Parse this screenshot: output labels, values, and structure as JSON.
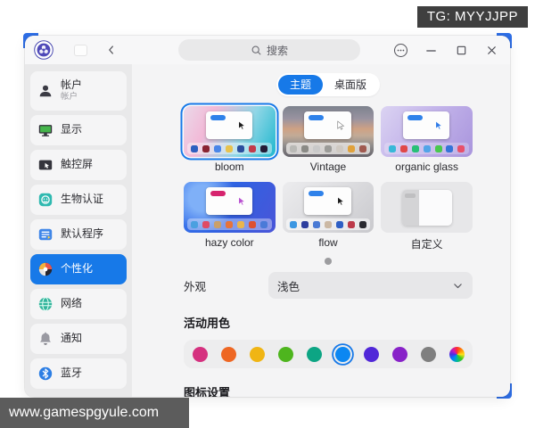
{
  "watermarks": {
    "top_right": "TG: MYYJJPP",
    "bottom_left": "www.gamespgyule.com"
  },
  "ui_colors": {
    "accent_blue": "#1779e8",
    "sidebar_bg": "#e9e9ea",
    "content_bg": "#f4f4f5"
  },
  "window": {
    "titlebar": {
      "search_placeholder": "搜索"
    },
    "sidebar": {
      "items": [
        {
          "label": "帐户",
          "sublabel": "帐户",
          "icon": "account-icon",
          "selected": false
        },
        {
          "label": "显示",
          "icon": "display-icon",
          "selected": false
        },
        {
          "label": "触控屏",
          "icon": "touchscreen-icon",
          "selected": false
        },
        {
          "label": "生物认证",
          "icon": "biometric-icon",
          "selected": false
        },
        {
          "label": "默认程序",
          "icon": "default-apps-icon",
          "selected": false
        },
        {
          "label": "个性化",
          "icon": "personalization-icon",
          "selected": true
        },
        {
          "label": "网络",
          "icon": "network-icon",
          "selected": false
        },
        {
          "label": "通知",
          "icon": "notification-icon",
          "selected": false
        },
        {
          "label": "蓝牙",
          "icon": "bluetooth-icon",
          "selected": false
        }
      ]
    },
    "main": {
      "tabs": [
        {
          "label": "主题",
          "selected": true
        },
        {
          "label": "桌面版",
          "selected": false
        }
      ],
      "themes": [
        {
          "name": "bloom",
          "selected": true,
          "custom": false,
          "bg": "linear-gradient(115deg,#ead9e9 0%,#f2b9d7 28%,#8ed6e6 65%,#1fb7ce 100%)",
          "pill": "#2f82ea",
          "cursor_fill": "#1a1a1a",
          "cursor_stroke": "#ffffff",
          "dock_bg": "rgba(255,255,255,0.42)",
          "dock_colors": [
            "#2f5fc0",
            "#8a2433",
            "#4a86e8",
            "#e8c24e",
            "#2a4e9e",
            "#c23a4a",
            "#241c36"
          ]
        },
        {
          "name": "Vintage",
          "selected": false,
          "custom": false,
          "bg": "linear-gradient(180deg,#7d828e 0%,#9a93a0 25%,#cfa184 45%,#c2ab97 58%,#8f8c8c 78%,#66636a 100%)",
          "pill": "#2f82ea",
          "cursor_fill": "#ffffff",
          "cursor_stroke": "#777777",
          "dock_bg": "rgba(235,233,230,0.8)",
          "dock_colors": [
            "#b9b9b6",
            "#8a8a86",
            "#c9c9c9",
            "#9b9b98",
            "#cfc9c2",
            "#e0a23c",
            "#a05a50"
          ]
        },
        {
          "name": "organic glass",
          "selected": false,
          "custom": false,
          "bg": "linear-gradient(125deg,#dbd3f2 0%,#c3b4ea 45%,#a995dd 100%)",
          "pill": "#2f82ea",
          "cursor_fill": "#2f7be8",
          "cursor_stroke": "#ffffff",
          "dock_bg": "rgba(255,255,255,0.25)",
          "dock_colors": [
            "#38b8d8",
            "#e04848",
            "#28c078",
            "#52a4e8",
            "#48c84e",
            "#3474d8",
            "#e8506a"
          ]
        },
        {
          "name": "hazy color",
          "selected": false,
          "custom": false,
          "bg": "radial-gradient(circle at 20% 32%, #7fb0f8 0 16%, rgba(127,176,248,0) 42%), linear-gradient(120deg,#3a78ee 0%,#2f62e2 45%,#4a55d8 100%)",
          "pill": "#d6246e",
          "cursor_fill": "#b84fd0",
          "cursor_stroke": "#ffffff",
          "dock_bg": "rgba(255,255,255,0.38)",
          "dock_colors": [
            "#4aa0e0",
            "#e04b64",
            "#caa06a",
            "#e8733a",
            "#eab54e",
            "#de5030",
            "#4a7ad8"
          ]
        },
        {
          "name": "flow",
          "selected": false,
          "custom": false,
          "bg": "linear-gradient(135deg,#ececee 0%,#dcdcdf 50%,#c9c9cd 100%)",
          "pill": "#2f82ea",
          "cursor_fill": "#1a1a1a",
          "cursor_stroke": "#ffffff",
          "dock_bg": "rgba(255,255,255,0.55)",
          "dock_colors": [
            "#3b97e2",
            "#2e3f9e",
            "#4a7ad4",
            "#cbb8a4",
            "#2f5fc4",
            "#bc3a4a",
            "#2a2a31"
          ]
        },
        {
          "name": "自定义",
          "selected": false,
          "custom": true,
          "bg": "#e7e7e9",
          "pill": "#bfbfc1",
          "cursor_fill": "",
          "cursor_stroke": "",
          "dock_bg": "",
          "dock_colors": []
        }
      ],
      "pager_dots": 1,
      "appearance": {
        "label": "外观",
        "value": "浅色"
      },
      "active_color": {
        "heading": "活动用色",
        "selected_index": 5,
        "colors": [
          "#d5317f",
          "#ee6723",
          "#f0b514",
          "#4eb51e",
          "#0da584",
          "#0c87f2",
          "#5128d8",
          "#8822c8",
          "#7f7f7f",
          "rainbow"
        ]
      },
      "icon_settings_heading": "图标设置"
    }
  }
}
